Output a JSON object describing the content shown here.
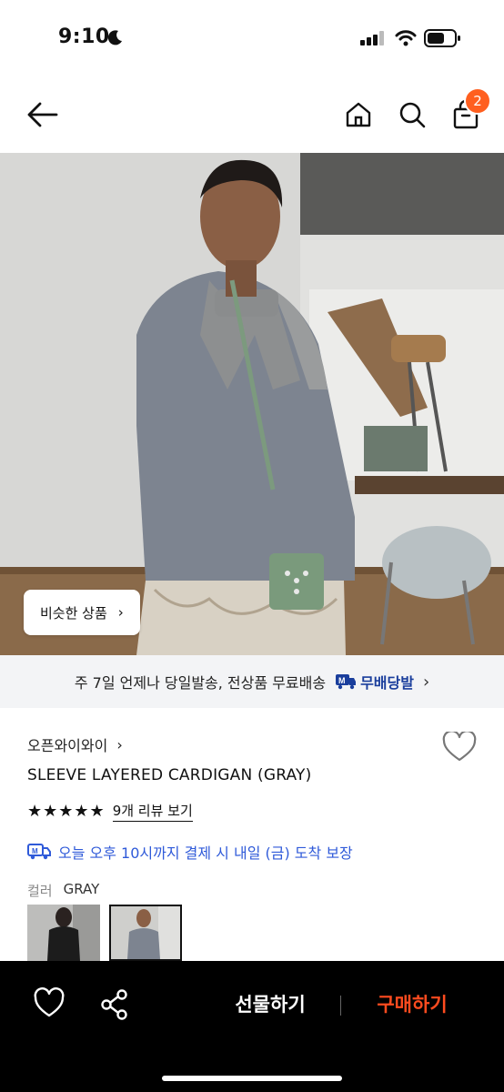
{
  "status_bar": {
    "time": "9:10"
  },
  "header": {
    "cart_count": "2"
  },
  "hero": {
    "similar_label": "비슷한 상품",
    "chevron": "›"
  },
  "shipping_banner": {
    "text": "주 7일 언제나 당일발송, 전상품 무료배송",
    "badge_label": "무배당발",
    "chevron": "›"
  },
  "product": {
    "brand": "오픈와이와이",
    "brand_chevron": "›",
    "name": "SLEEVE LAYERED CARDIGAN (GRAY)",
    "stars": "★★★★★",
    "review_link": "9개 리뷰 보기",
    "arrival_text": "오늘 오후 10시까지 결제 시 내일 (금) 도착 보장",
    "color_label": "컬러",
    "color_value": "GRAY"
  },
  "bottom_bar": {
    "gift_label": "선물하기",
    "buy_label": "구매하기"
  },
  "colors": {
    "accent": "#ff5f1f",
    "buy": "#ff4b1f",
    "link_blue": "#2f5ad9",
    "badge_navy": "#1a3e9c"
  }
}
